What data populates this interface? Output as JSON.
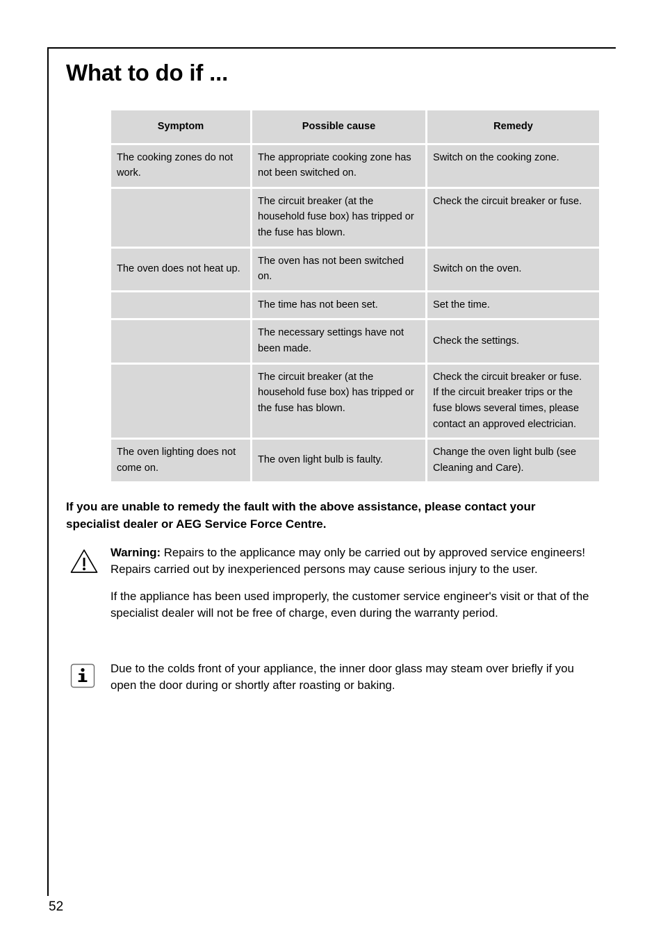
{
  "page": {
    "title": "What to do if ...",
    "number": "52",
    "frame_color": "#000000",
    "cell_color": "#d8d8d8"
  },
  "table": {
    "headers": [
      "Symptom",
      "Possible cause",
      "Remedy"
    ],
    "rows": [
      {
        "symptom": "The cooking zones do not work.",
        "cause": "The appropriate cooking zone has not been switched on.",
        "remedy": "Switch on the cooking zone."
      },
      {
        "symptom": "",
        "cause": "The circuit breaker (at the household fuse box) has tripped or the fuse has blown.",
        "remedy": "Check the circuit breaker or fuse."
      },
      {
        "symptom": "The oven does not heat up.",
        "cause": "The oven has not been switched on.",
        "remedy": "Switch on the oven."
      },
      {
        "symptom": "",
        "cause": "The time has not been set.",
        "remedy": "Set the time."
      },
      {
        "symptom": "",
        "cause": "The necessary settings have not been made.",
        "remedy": "Check the settings."
      },
      {
        "symptom": "",
        "cause": "The circuit breaker (at the household fuse box) has tripped or the fuse has blown.",
        "remedy": "Check the circuit breaker or fuse.\nIf the circuit breaker trips or the fuse blows several times, please contact an approved electrician."
      },
      {
        "symptom": "The oven lighting does not come on.",
        "cause": "The oven light bulb is faulty.",
        "remedy": "Change the oven light bulb (see Cleaning and Care)."
      }
    ]
  },
  "notes": {
    "lead_bold": "If you are unable to remedy the fault with the above assistance, please contact your specialist dealer or AEG Service Force Centre.",
    "warning_label": "Warning:",
    "warning_text": " Repairs to the applicance may only be carried out by approved service engineers! Repairs carried out by inexperienced persons may cause serious injury to the user.",
    "improper_use": "If the appliance has been used improperly, the customer service engineer's visit or that of the specialist dealer will not be free of charge, even during the warranty period.",
    "info_text": "Due to the colds front of your appliance, the inner door glass may steam over briefly if you open the door during or shortly after roasting or baking.",
    "warning_icon": "warning-triangle-icon",
    "info_icon": "information-icon"
  }
}
